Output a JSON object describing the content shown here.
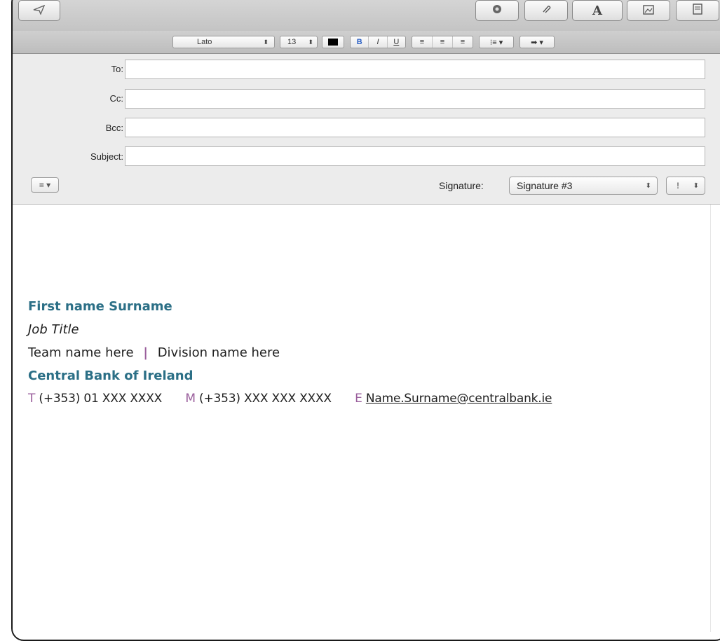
{
  "toolbar": {
    "send_icon": "send-icon",
    "buttons": [
      "emoji-icon",
      "attach-icon",
      "fonts-icon",
      "photo-browser-icon",
      "stationery-icon"
    ],
    "fonts_glyph": "A"
  },
  "format_bar": {
    "font_family": "Lato",
    "font_size": "13",
    "bold": "B",
    "italic": "I",
    "underline": "U",
    "text_color": "#000000"
  },
  "header": {
    "to_label": "To:",
    "cc_label": "Cc:",
    "bcc_label": "Bcc:",
    "subject_label": "Subject:",
    "to_value": "",
    "cc_value": "",
    "bcc_value": "",
    "subject_value": "",
    "signature_label": "Signature:",
    "signature_value": "Signature #3",
    "priority_value": "!"
  },
  "signature": {
    "name": "First name Surname",
    "job_title": "Job Title",
    "team": "Team name here",
    "separator": "|",
    "division": "Division name here",
    "company": "Central Bank of Ireland",
    "phone_label": "T",
    "phone": "(+353) 01 XXX XXXX",
    "mobile_label": "M",
    "mobile": "(+353) XXX XXX XXXX",
    "email_label": "E",
    "email": "Name.Surname@centralbank.ie"
  },
  "colors": {
    "accent_teal": "#2b6f86",
    "accent_purple": "#9a5e9c"
  }
}
